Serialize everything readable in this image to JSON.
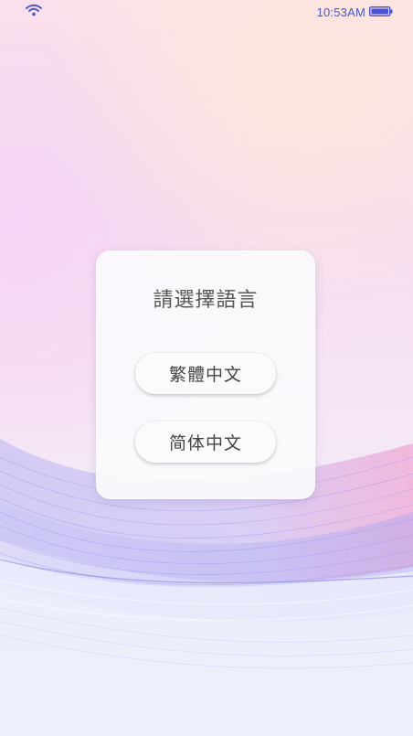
{
  "status_bar": {
    "time": "10:53AM",
    "wifi_icon": "wifi-icon",
    "battery_icon": "battery-icon",
    "accent_color": "#4b55d0"
  },
  "dialog": {
    "title": "請選擇語言",
    "options": [
      {
        "label": "繁體中文"
      },
      {
        "label": "简体中文"
      }
    ]
  }
}
